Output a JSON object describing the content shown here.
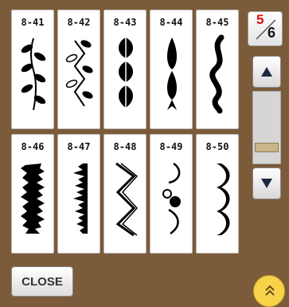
{
  "stitches": [
    {
      "code": "8-41",
      "icon": "leaf-branch-stitch-icon"
    },
    {
      "code": "8-42",
      "icon": "leaf-zigzag-stitch-icon"
    },
    {
      "code": "8-43",
      "icon": "fern-leaf-stitch-icon"
    },
    {
      "code": "8-44",
      "icon": "teardrop-chain-stitch-icon"
    },
    {
      "code": "8-45",
      "icon": "wave-ribbon-stitch-icon"
    },
    {
      "code": "8-46",
      "icon": "fringe-stitch-icon"
    },
    {
      "code": "8-47",
      "icon": "grass-edge-stitch-icon"
    },
    {
      "code": "8-48",
      "icon": "zigzag-outline-stitch-icon"
    },
    {
      "code": "8-49",
      "icon": "scallop-dots-stitch-icon"
    },
    {
      "code": "8-50",
      "icon": "scallop-edge-stitch-icon"
    }
  ],
  "page": {
    "current": "5",
    "total": "6"
  },
  "buttons": {
    "close_label": "CLOSE",
    "up_icon": "triangle-up-icon",
    "down_icon": "triangle-down-icon",
    "expand_icon": "double-chevron-up-icon"
  },
  "colors": {
    "background": "#7b5b39",
    "tile": "#ffffff",
    "page_current": "#e01010",
    "expand": "#f7d34a"
  }
}
